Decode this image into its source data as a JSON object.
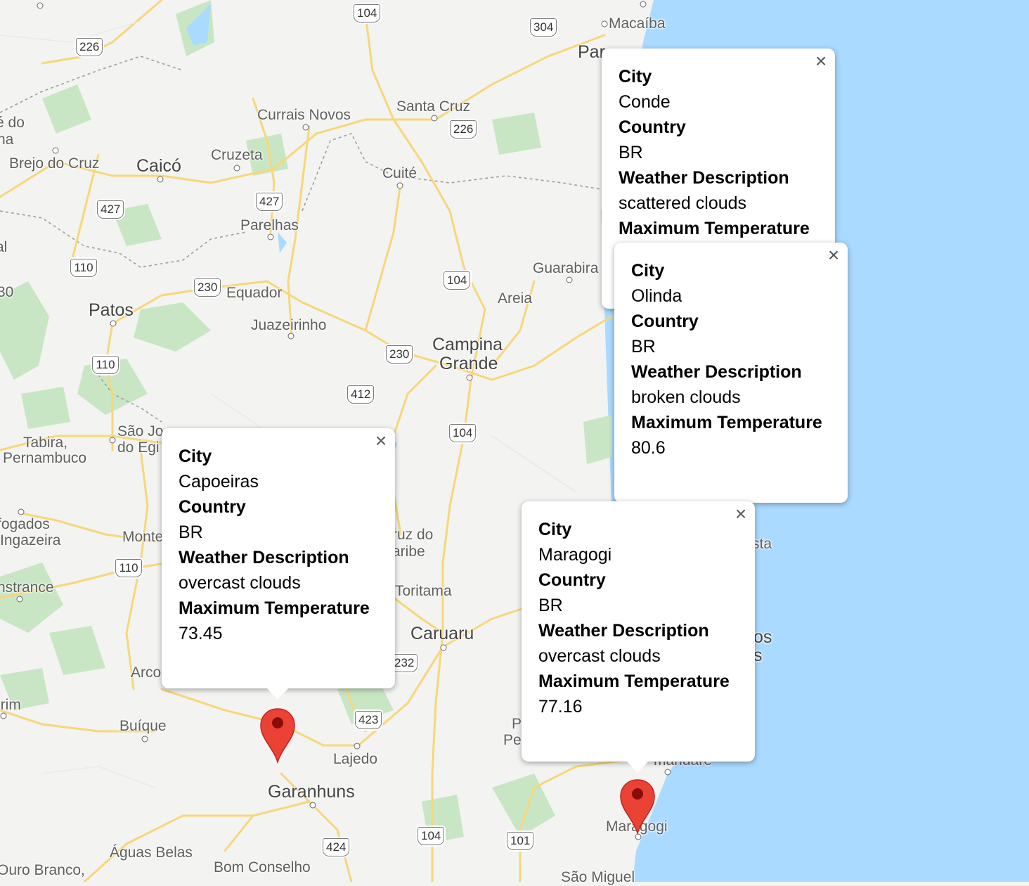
{
  "map": {
    "colors": {
      "land": "#f3f3f1",
      "water": "#aadaff",
      "road": "#f7d77a",
      "park": "#c8e6c4",
      "marker": "#ea4335"
    },
    "places": [
      {
        "id": "macaiba",
        "name": "Macaíba"
      },
      {
        "id": "par",
        "name": "Par"
      },
      {
        "id": "curraisnovos",
        "name": "Currais Novos"
      },
      {
        "id": "santacruz",
        "name": "Santa Cruz"
      },
      {
        "id": "edo",
        "name": "é do"
      },
      {
        "id": "na",
        "name": "na"
      },
      {
        "id": "brejodocruz",
        "name": "Brejo do Cruz"
      },
      {
        "id": "caico",
        "name": "Caicó"
      },
      {
        "id": "cruzeta",
        "name": "Cruzeta"
      },
      {
        "id": "cuite",
        "name": "Cuité"
      },
      {
        "id": "parelhas",
        "name": "Parelhas"
      },
      {
        "id": "al",
        "name": "al"
      },
      {
        "id": "guarabira",
        "name": "Guarabira"
      },
      {
        "id": "equador",
        "name": "Equador"
      },
      {
        "id": "areia",
        "name": "Areia"
      },
      {
        "id": "patos",
        "name": "Patos"
      },
      {
        "id": "juazeirinho",
        "name": "Juazeirinho"
      },
      {
        "id": "campinagrande1",
        "name": "Campina"
      },
      {
        "id": "campinagrande2",
        "name": "Grande"
      },
      {
        "id": "saojose1",
        "name": "São Jo"
      },
      {
        "id": "saojose2",
        "name": "do Egi"
      },
      {
        "id": "tabira1",
        "name": "Tabira,"
      },
      {
        "id": "tabira2",
        "name": "Pernambuco"
      },
      {
        "id": "afogados",
        "name": "fogados"
      },
      {
        "id": "ingazeira",
        "name": "Ingazeira"
      },
      {
        "id": "monte",
        "name": "Monte"
      },
      {
        "id": "ruzdo",
        "name": "ruz do"
      },
      {
        "id": "aribe",
        "name": "aribe"
      },
      {
        "id": "ista",
        "name": "sta"
      },
      {
        "id": "nstrance",
        "name": "nstrance"
      },
      {
        "id": "toritama",
        "name": "Toritama"
      },
      {
        "id": "caruaru",
        "name": "Caruaru"
      },
      {
        "id": "os",
        "name": "os"
      },
      {
        "id": "s",
        "name": "s"
      },
      {
        "id": "arco",
        "name": "Arco"
      },
      {
        "id": "irim",
        "name": "irim"
      },
      {
        "id": "buique",
        "name": "Buíque"
      },
      {
        "id": "p",
        "name": "P"
      },
      {
        "id": "pe",
        "name": "Pe"
      },
      {
        "id": "lajedo",
        "name": "Lajedo"
      },
      {
        "id": "mandare",
        "name": "mandaré"
      },
      {
        "id": "garanhuns",
        "name": "Garanhuns"
      },
      {
        "id": "maragogi",
        "name": "Maragogi"
      },
      {
        "id": "aguasbelas",
        "name": "Águas Belas"
      },
      {
        "id": "ourobranco",
        "name": "Ouro Branco,"
      },
      {
        "id": "bomconselho",
        "name": "Bom Conselho"
      },
      {
        "id": "saomiguel",
        "name": "São Miguel"
      },
      {
        "id": "n30",
        "name": "30"
      }
    ],
    "shields": [
      {
        "id": "s104a",
        "num": "104"
      },
      {
        "id": "s304",
        "num": "304"
      },
      {
        "id": "s226a",
        "num": "226"
      },
      {
        "id": "s226b",
        "num": "226"
      },
      {
        "id": "s427a",
        "num": "427"
      },
      {
        "id": "s427b",
        "num": "427"
      },
      {
        "id": "s110a",
        "num": "110"
      },
      {
        "id": "s230a",
        "num": "230"
      },
      {
        "id": "s104b",
        "num": "104"
      },
      {
        "id": "s110b",
        "num": "110"
      },
      {
        "id": "s230b",
        "num": "230"
      },
      {
        "id": "s412",
        "num": "412"
      },
      {
        "id": "s104c",
        "num": "104"
      },
      {
        "id": "s110c",
        "num": "110"
      },
      {
        "id": "s232",
        "num": "232"
      },
      {
        "id": "s423",
        "num": "423"
      },
      {
        "id": "s424",
        "num": "424"
      },
      {
        "id": "s104d",
        "num": "104"
      },
      {
        "id": "s101",
        "num": "101"
      }
    ]
  },
  "info_windows": [
    {
      "id": "conde",
      "city_label": "City",
      "city": "Conde",
      "country_label": "Country",
      "country": "BR",
      "desc_label": "Weather Description",
      "desc": "scattered clouds",
      "temp_label": "Maximum Temperature",
      "temp": ""
    },
    {
      "id": "olinda",
      "city_label": "City",
      "city": "Olinda",
      "country_label": "Country",
      "country": "BR",
      "desc_label": "Weather Description",
      "desc": "broken clouds",
      "temp_label": "Maximum Temperature",
      "temp": "80.6"
    },
    {
      "id": "capoeiras",
      "city_label": "City",
      "city": "Capoeiras",
      "country_label": "Country",
      "country": "BR",
      "desc_label": "Weather Description",
      "desc": "overcast clouds",
      "temp_label": "Maximum Temperature",
      "temp": "73.45"
    },
    {
      "id": "maragogi",
      "city_label": "City",
      "city": "Maragogi",
      "country_label": "Country",
      "country": "BR",
      "desc_label": "Weather Description",
      "desc": "overcast clouds",
      "temp_label": "Maximum Temperature",
      "temp": "77.16"
    }
  ],
  "close_glyph": "×"
}
